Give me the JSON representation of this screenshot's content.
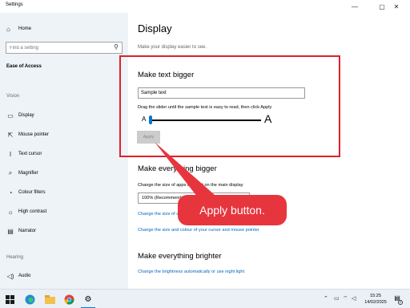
{
  "window": {
    "title": "Settings",
    "controls": {
      "minimize": "—",
      "maximize": "▢",
      "close": "✕"
    }
  },
  "sidebar": {
    "home": {
      "label": "Home",
      "icon": "home-icon"
    },
    "search": {
      "placeholder": "Find a setting"
    },
    "section_title": "Ease of Access",
    "group_vision": "Vision",
    "items": [
      {
        "label": "Display",
        "icon": "display-icon",
        "glyph": "▭"
      },
      {
        "label": "Mouse pointer",
        "icon": "mouse-pointer-icon",
        "glyph": "⇱"
      },
      {
        "label": "Text cursor",
        "icon": "text-cursor-icon",
        "glyph": "I"
      },
      {
        "label": "Magnifier",
        "icon": "magnifier-icon",
        "glyph": "⌕"
      },
      {
        "label": "Colour filters",
        "icon": "colour-filters-icon",
        "glyph": "◔"
      },
      {
        "label": "High contrast",
        "icon": "high-contrast-icon",
        "glyph": "☼"
      },
      {
        "label": "Narrator",
        "icon": "narrator-icon",
        "glyph": "▤"
      }
    ],
    "group_hearing": "Hearing",
    "hearing_items": [
      {
        "label": "Audio",
        "icon": "audio-icon",
        "glyph": "◁)"
      }
    ]
  },
  "main": {
    "title": "Display",
    "subtitle": "Make your display easier to see.",
    "text_bigger": {
      "heading": "Make text bigger",
      "sample_text": "Sample text",
      "instruction": "Drag the slider until the sample text is easy to read, then click Apply",
      "slider_min_label": "A",
      "slider_max_label": "A",
      "slider_value_fraction": 0.0,
      "apply_label": "Apply"
    },
    "everything_bigger": {
      "heading": "Make everything bigger",
      "instruction": "Change the size of apps and text on the main display",
      "dropdown_value": "100% (Recommended)",
      "link_other": "Change the size of apps and text on other displays",
      "link_cursor": "Change the size and colour of your cursor and mouse pointer"
    },
    "everything_brighter": {
      "heading": "Make everything brighter",
      "link": "Change the brightness automatically or use night light"
    }
  },
  "annotation": {
    "callout_text": "Apply button.",
    "color": "#e0202a"
  },
  "taskbar": {
    "time": "15:25",
    "date": "14/02/2025",
    "notification_count": "2"
  }
}
